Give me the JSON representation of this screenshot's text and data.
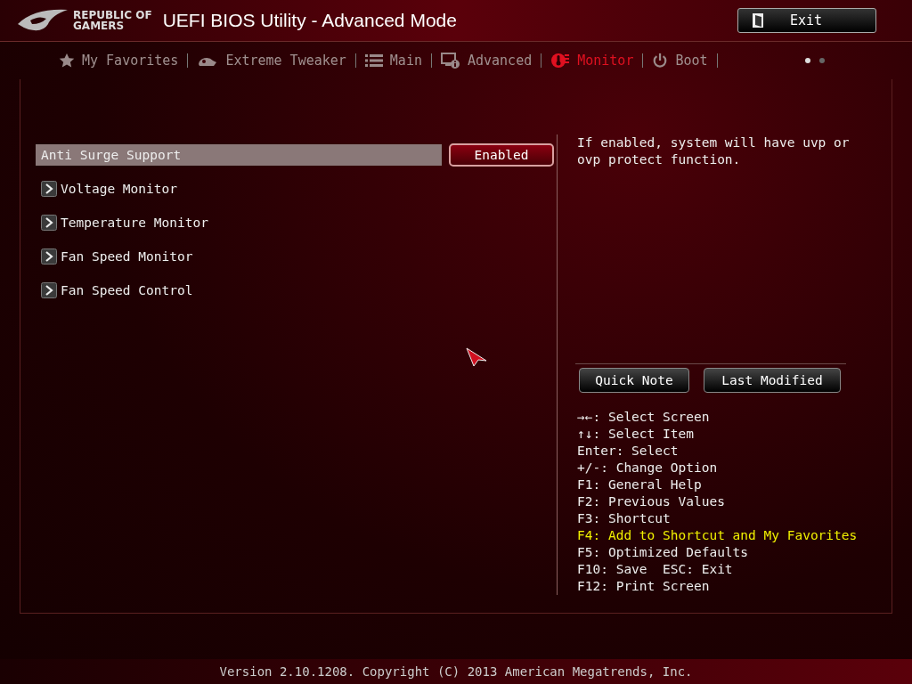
{
  "window": {
    "logo_lines": [
      "REPUBLIC OF",
      "GAMERS"
    ],
    "title": "UEFI BIOS Utility - Advanced Mode",
    "exit_button": "Exit"
  },
  "tabs": [
    {
      "label": "My Favorites",
      "selected": false
    },
    {
      "label": "Extreme Tweaker",
      "selected": false
    },
    {
      "label": "Main",
      "selected": false
    },
    {
      "label": "Advanced",
      "selected": false
    },
    {
      "label": "Monitor",
      "selected": true
    },
    {
      "label": "Boot",
      "selected": false
    }
  ],
  "page_dots": [
    {
      "selected": true
    },
    {
      "selected": false
    }
  ],
  "items": [
    {
      "kind": "setting",
      "label": "Anti Surge Support",
      "value": "Enabled",
      "selected": true
    },
    {
      "kind": "submenu",
      "label": "Voltage Monitor",
      "selected": false
    },
    {
      "kind": "submenu",
      "label": "Temperature Monitor",
      "selected": false
    },
    {
      "kind": "submenu",
      "label": "Fan Speed Monitor",
      "selected": false
    },
    {
      "kind": "submenu",
      "label": "Fan Speed Control",
      "selected": false
    }
  ],
  "help_text": "If enabled, system will have uvp or ovp protect function.",
  "side_buttons": [
    "Quick Note",
    "Last Modified"
  ],
  "key_hints": [
    {
      "text": "→←: Select Screen",
      "highlighted": false
    },
    {
      "text": "↑↓: Select Item",
      "highlighted": false
    },
    {
      "text": "Enter: Select",
      "highlighted": false
    },
    {
      "text": "+/-: Change Option",
      "highlighted": false
    },
    {
      "text": "F1: General Help",
      "highlighted": false
    },
    {
      "text": "F2: Previous Values",
      "highlighted": false
    },
    {
      "text": "F3: Shortcut",
      "highlighted": false
    },
    {
      "text": "F4: Add to Shortcut and My Favorites",
      "highlighted": true
    },
    {
      "text": "F5: Optimized Defaults",
      "highlighted": false
    },
    {
      "text": "F10: Save  ESC: Exit",
      "highlighted": false
    },
    {
      "text": "F12: Print Screen",
      "highlighted": false
    }
  ],
  "status_bar": "Version 2.10.1208. Copyright (C) 2013 American Megatrends, Inc."
}
